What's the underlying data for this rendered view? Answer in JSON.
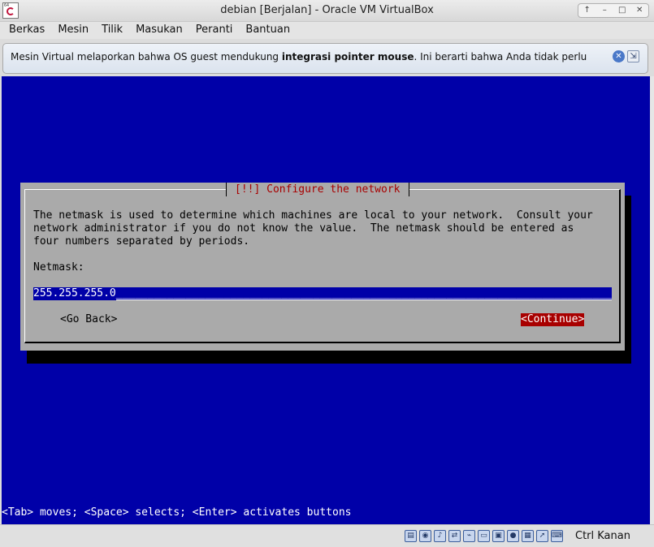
{
  "window": {
    "title": "debian [Berjalan] - Oracle VM VirtualBox",
    "controls": [
      "↑",
      "–",
      "□",
      "✕"
    ]
  },
  "menubar": [
    "Berkas",
    "Mesin",
    "Tilik",
    "Masukan",
    "Peranti",
    "Bantuan"
  ],
  "notice": {
    "text_before": "Mesin Virtual melaporkan bahwa OS guest mendukung ",
    "text_bold": "integrasi pointer mouse",
    "text_after": ". Ini berarti bahwa Anda tidak perlu"
  },
  "installer": {
    "dialog_title": "[!!] Configure the network",
    "description": "The netmask is used to determine which machines are local to your network.  Consult your\nnetwork administrator if you do not know the value.  The netmask should be entered as\nfour numbers separated by periods.",
    "field_label": "Netmask:",
    "field_value": "255.255.255.0",
    "back_button": "<Go Back>",
    "continue_button": "<Continue>",
    "key_hint": "<Tab> moves; <Space> selects; <Enter> activates buttons"
  },
  "statusbar": {
    "host_key": "Ctrl Kanan",
    "icons": [
      "hard-disk-icon",
      "optical-drive-icon",
      "audio-icon",
      "network-icon",
      "usb-icon",
      "shared-folders-icon",
      "display-icon",
      "video-capture-icon",
      "cpu-icon",
      "mouse-integration-icon",
      "keyboard-capture-icon"
    ]
  }
}
